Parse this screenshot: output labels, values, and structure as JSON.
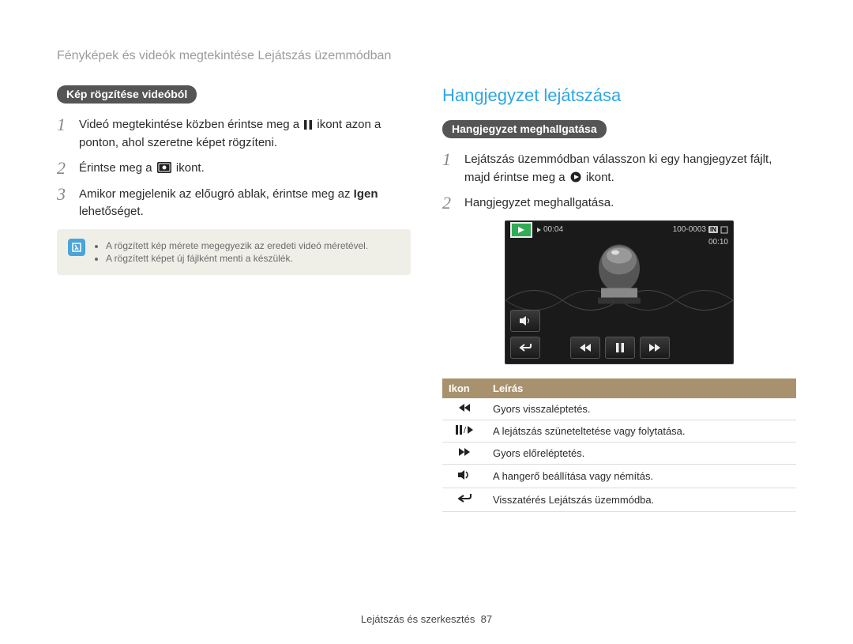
{
  "breadcrumb": "Fényképek és videók megtekintése Lejátszás üzemmódban",
  "left": {
    "pill": "Kép rögzítése videóból",
    "steps": [
      {
        "n": "1",
        "pre": "Videó megtekintése közben érintse meg a ",
        "post": " ikont azon a ponton, ahol szeretne képet rögzíteni.",
        "icon": "pause"
      },
      {
        "n": "2",
        "pre": "Érintse meg a ",
        "post": " ikont.",
        "icon": "capture"
      },
      {
        "n": "3",
        "pre": "Amikor megjelenik az előugró ablak, érintse meg az ",
        "bold": "Igen",
        "post": " lehetőséget."
      }
    ],
    "note": [
      "A rögzített kép mérete megegyezik az eredeti videó méretével.",
      "A rögzített képet új fájlként menti a készülék."
    ]
  },
  "right": {
    "title": "Hangjegyzet lejátszása",
    "pill": "Hangjegyzet meghallgatása",
    "steps": [
      {
        "n": "1",
        "pre": "Lejátszás üzemmódban válasszon ki egy hangjegyzet fájlt, majd érintse meg a ",
        "post": " ikont.",
        "icon": "play"
      },
      {
        "n": "2",
        "pre": "Hangjegyzet meghallgatása."
      }
    ],
    "player": {
      "elapsed": "00:04",
      "filecode": "100-0003",
      "total": "00:10",
      "sd": "IN"
    },
    "table": {
      "head": {
        "icon": "Ikon",
        "desc": "Leírás"
      },
      "rows": [
        {
          "icon": "rewind",
          "desc": "Gyors visszaléptetés."
        },
        {
          "icon": "pauseplay",
          "desc": "A lejátszás szüneteltetése vagy folytatása."
        },
        {
          "icon": "forward",
          "desc": "Gyors előreléptetés."
        },
        {
          "icon": "volume",
          "desc": "A hangerő beállítása vagy némítás."
        },
        {
          "icon": "back",
          "desc": "Visszatérés Lejátszás üzemmódba."
        }
      ]
    }
  },
  "footer": {
    "label": "Lejátszás és szerkesztés",
    "page": "87"
  }
}
